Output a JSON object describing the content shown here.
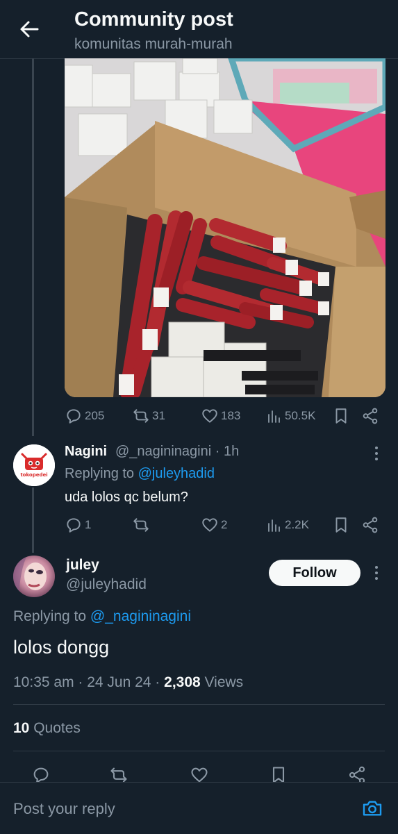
{
  "header": {
    "title": "Community post",
    "subtitle": "komunitas murah-murah"
  },
  "post_actions": {
    "replies": "205",
    "reposts": "31",
    "likes": "183",
    "views": "50.5K"
  },
  "reply": {
    "avatar_label": "tokopedei",
    "name": "Nagini",
    "handle": "@_nagininagini · 1h",
    "replying_prefix": "Replying to",
    "replying_to": "@juleyhadid",
    "text": "uda lolos qc belum?",
    "actions": {
      "replies": "1",
      "reposts": "",
      "likes": "2",
      "views": "2.2K"
    }
  },
  "main_tweet": {
    "name": "juley",
    "handle": "@juleyhadid",
    "follow_label": "Follow",
    "replying_prefix": "Replying to",
    "replying_to": "@_nagininagini",
    "text": "lolos dongg",
    "time": "10:35 am · 24 Jun 24 · ",
    "views_count": "2,308",
    "views_label": " Views",
    "quotes_count": "10",
    "quotes_label": " Quotes"
  },
  "composer": {
    "placeholder": "Post your reply"
  },
  "colors": {
    "background": "#15202b",
    "accent": "#1d9bf0",
    "muted": "#8b98a5"
  }
}
